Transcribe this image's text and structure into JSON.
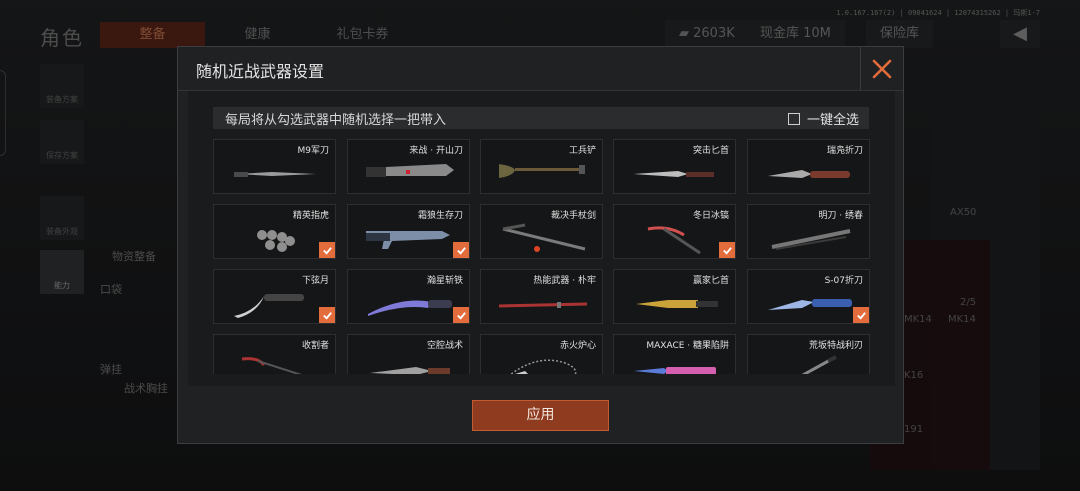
{
  "version": "1.0.167.167(2) | 09041624 | 12074315262 | 玛斯1-7",
  "background": {
    "title": "角色",
    "tabs": [
      {
        "label": "整备",
        "active": true
      },
      {
        "label": "健康",
        "active": false
      },
      {
        "label": "礼包卡券",
        "active": false
      }
    ],
    "currency": "2603K",
    "vault": "现金库 10M",
    "insurance": "保险库",
    "side_items": [
      {
        "label": "装备方案"
      },
      {
        "label": "保存方案"
      },
      {
        "label": "装备外观"
      },
      {
        "label": "能力"
      }
    ],
    "section_label": "物资整备",
    "pocket_label": "口袋",
    "ammo_label": "弹挂",
    "vest_label": "战术胸挂",
    "right_labels": [
      "AX50",
      "2/5",
      "MK14",
      "MK14",
      "K16",
      "191"
    ]
  },
  "modal": {
    "title": "随机近战武器设置",
    "hint": "每局将从勾选武器中随机选择一把带入",
    "select_all": "一键全选",
    "apply": "应用",
    "accent": "#e26c3b",
    "weapons": [
      {
        "name": "M9军刀",
        "checked": false,
        "icon": "bayonet-knife-icon"
      },
      {
        "name": "来战 · 开山刀",
        "checked": false,
        "icon": "machete-icon"
      },
      {
        "name": "工兵铲",
        "checked": false,
        "icon": "shovel-icon"
      },
      {
        "name": "突击匕首",
        "checked": false,
        "icon": "dagger-icon"
      },
      {
        "name": "瑞凫折刀",
        "checked": false,
        "icon": "folding-knife-icon"
      },
      {
        "name": "精英指虎",
        "checked": true,
        "icon": "knuckles-icon"
      },
      {
        "name": "霜狼生存刀",
        "checked": true,
        "icon": "survival-knife-icon"
      },
      {
        "name": "裁决手杖剑",
        "checked": false,
        "icon": "cane-sword-icon"
      },
      {
        "name": "冬日冰镐",
        "checked": true,
        "icon": "ice-axe-icon"
      },
      {
        "name": "明刀 · 绣春",
        "checked": false,
        "icon": "sheathed-blade-icon"
      },
      {
        "name": "下弦月",
        "checked": true,
        "icon": "karambit-icon"
      },
      {
        "name": "瀚星斩铁",
        "checked": true,
        "icon": "kukri-icon"
      },
      {
        "name": "热能武器 · 朴牢",
        "checked": false,
        "icon": "katana-icon"
      },
      {
        "name": "赢家匕首",
        "checked": false,
        "icon": "gold-dagger-icon"
      },
      {
        "name": "S-07折刀",
        "checked": true,
        "icon": "blue-folding-knife-icon"
      },
      {
        "name": "收割者",
        "checked": false,
        "icon": "scythe-icon"
      },
      {
        "name": "空腔战术",
        "checked": false,
        "icon": "tactical-knife-icon"
      },
      {
        "name": "赤火炉心",
        "checked": false,
        "icon": "chain-blade-icon"
      },
      {
        "name": "MAXACE · 糖果陷阱",
        "checked": false,
        "icon": "candy-knife-icon"
      },
      {
        "name": "荒坂特战利刃",
        "checked": false,
        "icon": "spec-ops-blade-icon"
      }
    ]
  }
}
